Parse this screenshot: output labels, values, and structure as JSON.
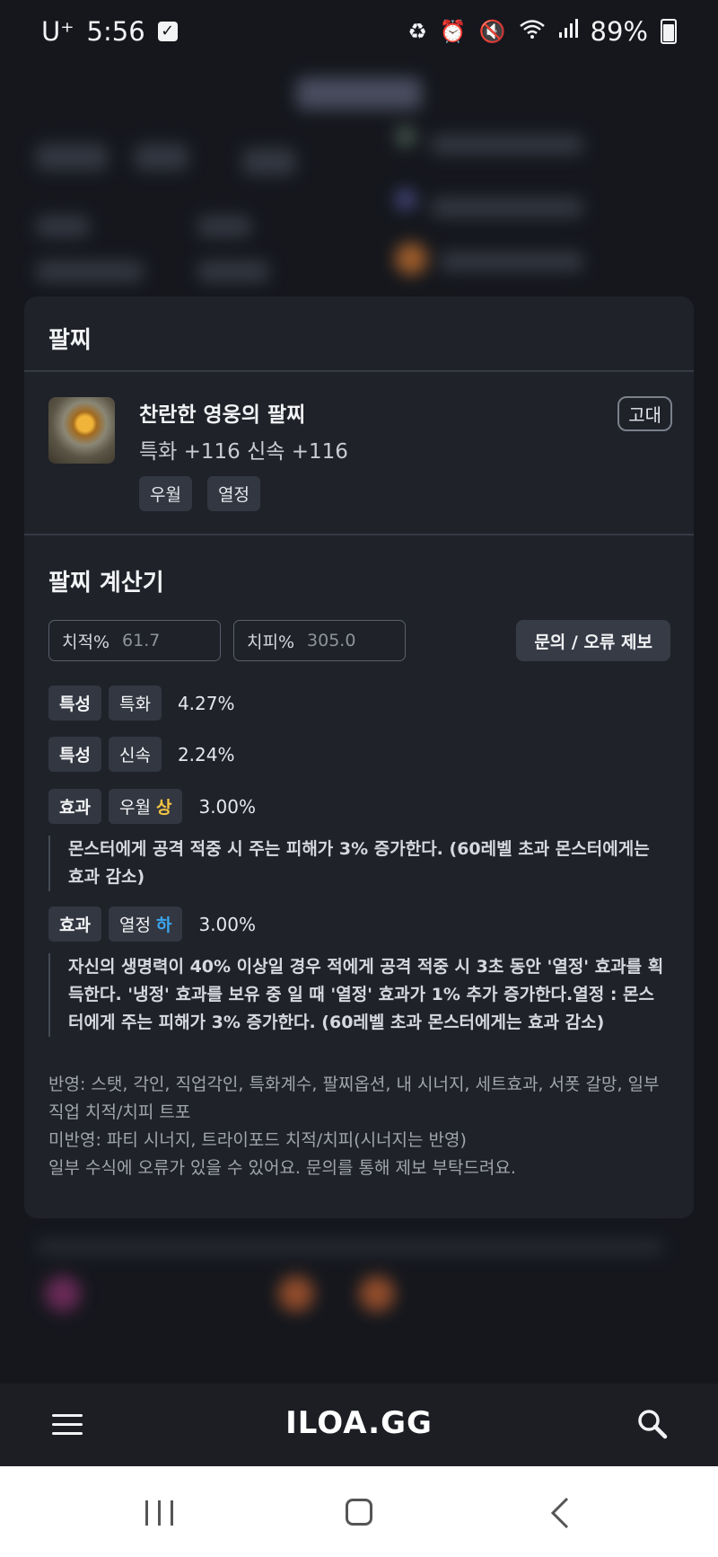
{
  "status_bar": {
    "carrier": "U⁺",
    "time": "5:56",
    "battery": "89%"
  },
  "sheet": {
    "title": "팔찌",
    "item": {
      "name": "찬란한 영웅의 팔찌",
      "stats": "특화 +116  신속 +116",
      "grade": "고대",
      "tags": [
        "우월",
        "열정"
      ]
    },
    "calculator": {
      "title": "팔찌 계산기",
      "crit_label": "치적%",
      "crit_value": "61.7",
      "critdmg_label": "치피%",
      "critdmg_value": "305.0",
      "report_button": "문의 / 오류 제보",
      "rows": [
        {
          "kind": "특성",
          "name": "특화",
          "value": "4.27%"
        },
        {
          "kind": "특성",
          "name": "신속",
          "value": "2.24%"
        },
        {
          "kind": "효과",
          "name": "우월",
          "level": "상",
          "value": "3.00%",
          "desc": "몬스터에게 공격 적중 시 주는 피해가 3% 증가한다. (60레벨 초과 몬스터에게는 효과 감소)"
        },
        {
          "kind": "효과",
          "name": "열정",
          "level": "하",
          "value": "3.00%",
          "desc": "자신의 생명력이 40% 이상일 경우 적에게 공격 적중 시 3초 동안 '열정' 효과를 획득한다. '냉정' 효과를 보유 중 일 때 '열정' 효과가 1% 추가 증가한다.열정 : 몬스터에게 주는 피해가 3% 증가한다. (60레벨 초과 몬스터에게는 효과 감소)"
        }
      ],
      "notes": [
        "반영: 스탯, 각인, 직업각인, 특화계수, 팔찌옵션, 내 시너지, 세트효과, 서폿 갈망, 일부 직업 치적/치피 트포",
        "미반영: 파티 시너지, 트라이포드 치적/치피(시너지는 반영)",
        "일부 수식에 오류가 있을 수 있어요. 문의를 통해 제보 부탁드려요."
      ]
    }
  },
  "app_bar": {
    "brand": "ILOA.GG",
    "menu_icon": "menu-icon",
    "search_icon": "search-icon"
  },
  "colors": {
    "level_high": "#f4c542",
    "level_low": "#3aa7f0",
    "sheet_bg": "#1f2229"
  }
}
